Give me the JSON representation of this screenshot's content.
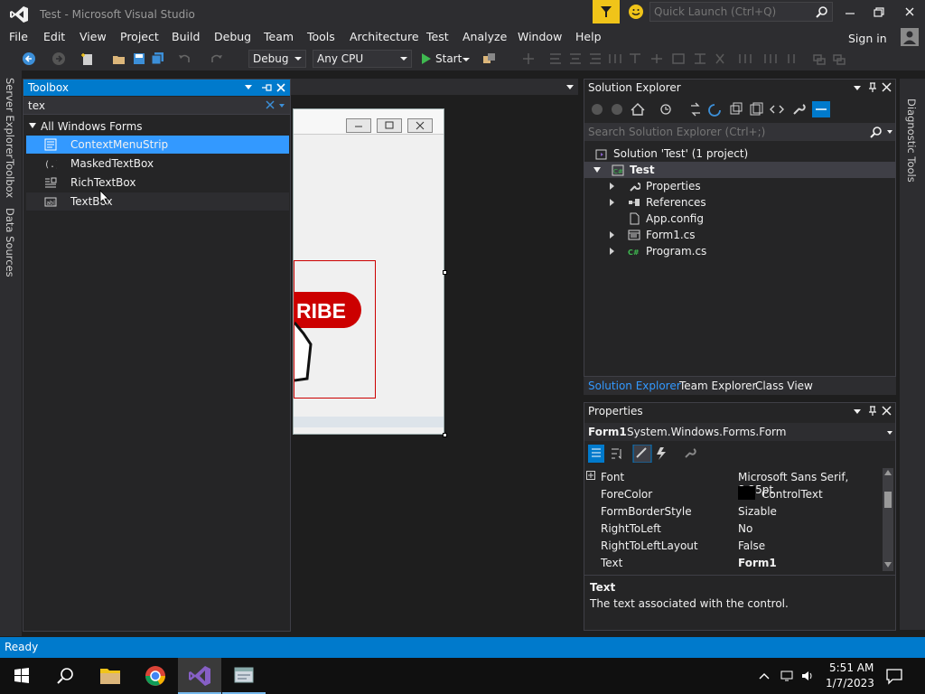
{
  "window": {
    "title": "Test - Microsoft Visual Studio",
    "quick_launch_placeholder": "Quick Launch (Ctrl+Q)"
  },
  "menu": [
    "File",
    "Edit",
    "View",
    "Project",
    "Build",
    "Debug",
    "Team",
    "Tools",
    "Architecture",
    "Test",
    "Analyze",
    "Window",
    "Help"
  ],
  "signin": "Sign in",
  "toolbar": {
    "configuration": "Debug",
    "platform": "Any CPU",
    "start_label": "Start"
  },
  "left_tabs": [
    "Server Explorer",
    "Toolbox",
    "Data Sources"
  ],
  "toolbox": {
    "title": "Toolbox",
    "search_value": "tex",
    "group": "All Windows Forms",
    "items": [
      {
        "label": "ContextMenuStrip",
        "icon": "context-menu-icon"
      },
      {
        "label": "MaskedTextBox",
        "icon": "masked-textbox-icon"
      },
      {
        "label": "RichTextBox",
        "icon": "rich-textbox-icon"
      },
      {
        "label": "TextBox",
        "icon": "textbox-icon"
      }
    ]
  },
  "designer": {
    "picture_text": "RIBE"
  },
  "solution_explorer": {
    "title": "Solution Explorer",
    "search_placeholder": "Search Solution Explorer (Ctrl+;)",
    "solution": "Solution 'Test' (1 project)",
    "project": "Test",
    "items": [
      "Properties",
      "References",
      "App.config",
      "Form1.cs",
      "Program.cs"
    ]
  },
  "panel_tabs": [
    "Solution Explorer",
    "Team Explorer",
    "Class View"
  ],
  "properties": {
    "title": "Properties",
    "object_name": "Form1",
    "object_type": "System.Windows.Forms.Form",
    "rows": [
      {
        "name": "Font",
        "value": "Microsoft Sans Serif, 8.25pt"
      },
      {
        "name": "ForeColor",
        "value": "ControlText"
      },
      {
        "name": "FormBorderStyle",
        "value": "Sizable"
      },
      {
        "name": "RightToLeft",
        "value": "No"
      },
      {
        "name": "RightToLeftLayout",
        "value": "False"
      },
      {
        "name": "Text",
        "value": "Form1"
      }
    ],
    "desc_title": "Text",
    "desc_text": "The text associated with the control."
  },
  "right_tabs": [
    "Diagnostic Tools"
  ],
  "status": "Ready",
  "taskbar": {
    "time": "5:51 AM",
    "date": "1/7/2023"
  },
  "colors": {
    "accent": "#007acc",
    "selection": "#3399ff",
    "vs_purple": "#865fc5"
  }
}
